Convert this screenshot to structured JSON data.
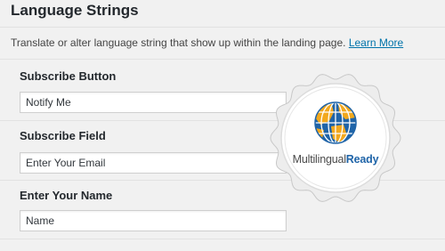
{
  "page": {
    "title": "Language Strings",
    "description": "Translate or alter language string that show up within the landing page.",
    "learn_more": "Learn More"
  },
  "fields": [
    {
      "label": "Subscribe Button",
      "value": "Notify Me"
    },
    {
      "label": "Subscribe Field",
      "value": "Enter Your Email"
    },
    {
      "label": "Enter Your Name",
      "value": "Name"
    }
  ],
  "badge": {
    "text_plain": "Multilingual",
    "text_bold": "Ready",
    "colors": {
      "blue": "#1f64a8",
      "orange": "#f2a81d"
    }
  }
}
